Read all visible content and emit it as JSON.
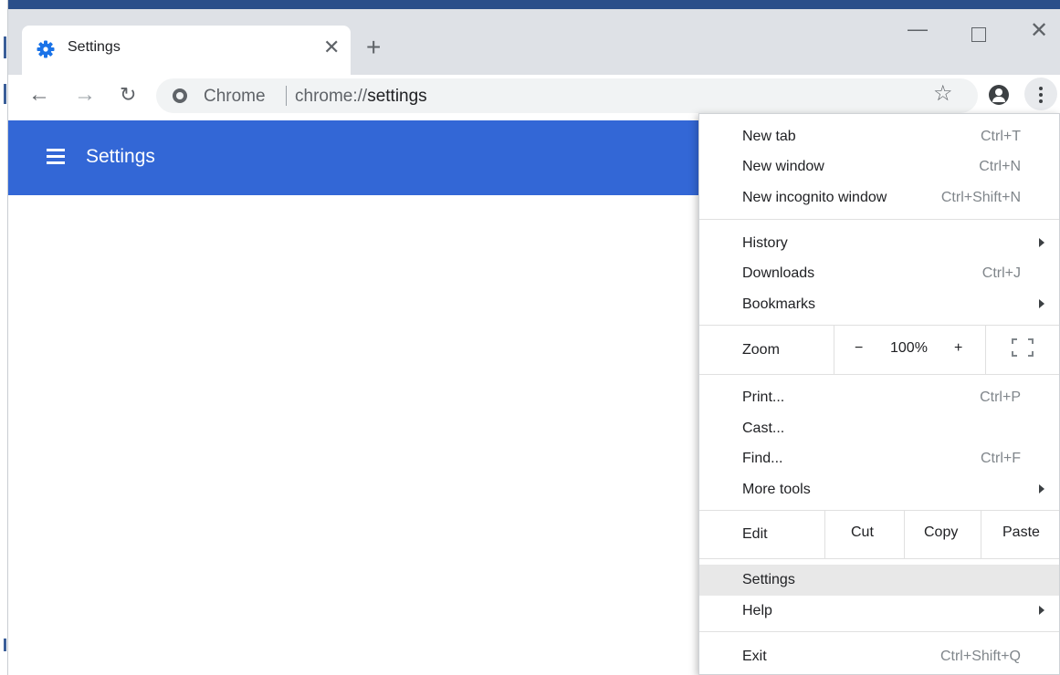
{
  "tab": {
    "title": "Settings",
    "favicon": "gear-icon"
  },
  "toolbar": {
    "site_name": "Chrome",
    "url_scheme": "chrome://",
    "url_path": "settings"
  },
  "header": {
    "title": "Settings"
  },
  "menu": {
    "group1": [
      {
        "label": "New tab",
        "shortcut": "Ctrl+T"
      },
      {
        "label": "New window",
        "shortcut": "Ctrl+N"
      },
      {
        "label": "New incognito window",
        "shortcut": "Ctrl+Shift+N"
      }
    ],
    "group2": [
      {
        "label": "History",
        "shortcut": ""
      },
      {
        "label": "Downloads",
        "shortcut": "Ctrl+J"
      },
      {
        "label": "Bookmarks",
        "shortcut": ""
      }
    ],
    "zoom": {
      "label": "Zoom",
      "minus": "−",
      "value": "100%",
      "plus": "+"
    },
    "group3": [
      {
        "label": "Print...",
        "shortcut": "Ctrl+P"
      },
      {
        "label": "Cast...",
        "shortcut": ""
      },
      {
        "label": "Find...",
        "shortcut": "Ctrl+F"
      },
      {
        "label": "More tools",
        "shortcut": ""
      }
    ],
    "edit": {
      "label": "Edit",
      "cut": "Cut",
      "copy": "Copy",
      "paste": "Paste"
    },
    "group4": [
      {
        "label": "Settings",
        "shortcut": ""
      },
      {
        "label": "Help",
        "shortcut": ""
      }
    ],
    "exit": {
      "label": "Exit",
      "shortcut": "Ctrl+Shift+Q"
    }
  },
  "colors": {
    "accent": "#3367d6",
    "tabstrip": "#dee1e6",
    "highlight": "#e8e8e8"
  }
}
